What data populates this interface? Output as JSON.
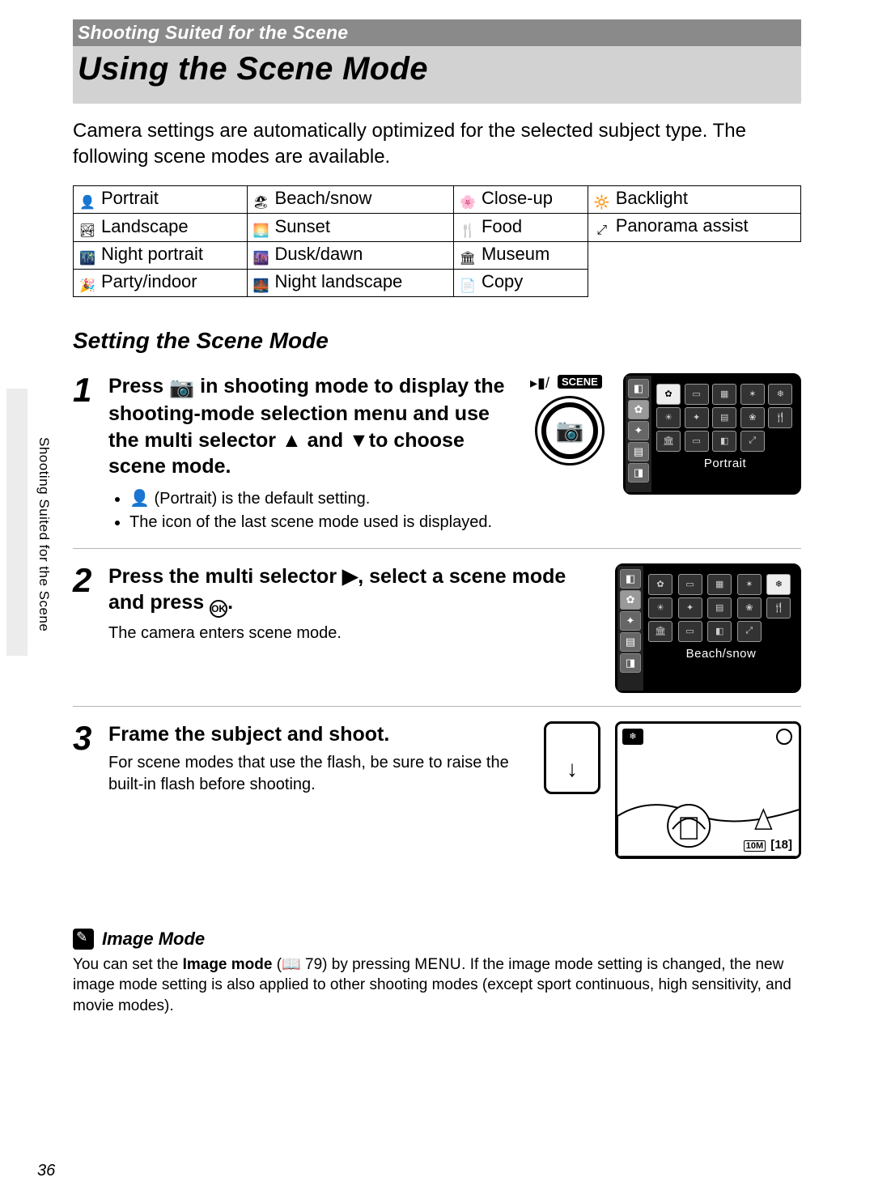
{
  "breadcrumb": "Shooting Suited for the Scene",
  "title": "Using the Scene Mode",
  "intro": "Camera settings are automatically optimized for the selected subject type. The following scene modes are available.",
  "scene_table": {
    "rows": [
      [
        "Portrait",
        "Beach/snow",
        "Close-up",
        "Backlight"
      ],
      [
        "Landscape",
        "Sunset",
        "Food",
        "Panorama assist"
      ],
      [
        "Night portrait",
        "Dusk/dawn",
        "Museum",
        ""
      ],
      [
        "Party/indoor",
        "Night landscape",
        "Copy",
        ""
      ]
    ],
    "icons": [
      [
        "portrait-icon",
        "beach-snow-icon",
        "close-up-icon",
        "backlight-icon"
      ],
      [
        "landscape-icon",
        "sunset-icon",
        "food-icon",
        "panorama-icon"
      ],
      [
        "night-portrait-icon",
        "dusk-dawn-icon",
        "museum-icon",
        ""
      ],
      [
        "party-indoor-icon",
        "night-landscape-icon",
        "copy-icon",
        ""
      ]
    ]
  },
  "section_setting": "Setting the Scene Mode",
  "steps": {
    "s1": {
      "num": "1",
      "text_a": "Press ",
      "text_b": " in shooting mode to display the shooting-mode selection menu and use the multi selector ",
      "text_c": " and ",
      "text_d": "to choose scene mode.",
      "bullet1_a": "(Portrait) is the default setting.",
      "bullet2": "The icon of the last scene mode used is displayed.",
      "lcd_scene_label": "SCENE",
      "lcd_caption": "Portrait"
    },
    "s2": {
      "num": "2",
      "text_a": "Press the multi selector ",
      "text_b": ", select a scene mode and press ",
      "text_c": ".",
      "sub": "The camera enters scene mode.",
      "lcd_caption": "Beach/snow"
    },
    "s3": {
      "num": "3",
      "text": "Frame the subject and shoot.",
      "sub": "For scene modes that use the flash, be sure to raise the built-in flash before shooting.",
      "shots_remaining": "18",
      "size_label": "10M"
    }
  },
  "footnote": {
    "heading": "Image Mode",
    "body_a": "You can set the ",
    "body_strong": "Image mode",
    "body_b": " (",
    "page_ref": "79",
    "body_c": ") by pressing ",
    "menu_label": "MENU",
    "body_d": ". If the image mode setting is changed, the new image mode setting is also applied to other shooting modes (except sport continuous, high sensitivity, and movie modes)."
  },
  "page_number": "36",
  "side_label": "Shooting Suited for the Scene",
  "icon_glyphs": {
    "portrait": "👤",
    "beach": "🏖",
    "closeup": "🌸",
    "backlight": "🔆",
    "landscape": "🏞",
    "sunset": "🌅",
    "food": "🍴",
    "panorama": "⤢",
    "night_portrait": "🌃",
    "dusk": "🌆",
    "museum": "🏛",
    "party": "🎉",
    "night_landscape": "🌉",
    "copy": "📄",
    "camera": "📷",
    "up": "▲",
    "down": "▼",
    "right": "▶",
    "ok": "OK",
    "book": "📖"
  }
}
